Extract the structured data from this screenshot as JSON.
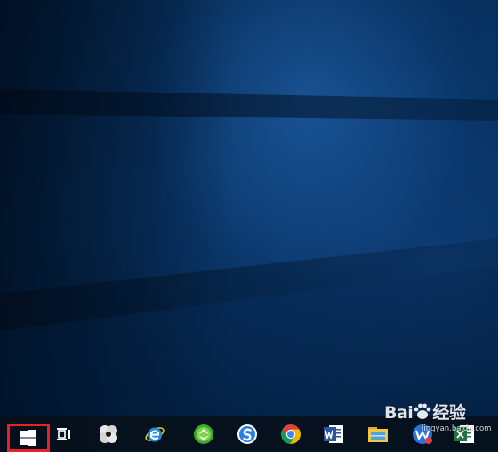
{
  "desktop": {
    "wallpaper": "windows-10-hero-blue",
    "accent_colors": {
      "background_dark": "#021c3a",
      "background_light": "#2a6ebe",
      "taskbar": "#06101c",
      "highlight_border": "#e8202a"
    }
  },
  "taskbar": {
    "items": [
      {
        "name": "start-button",
        "icon": "windows-logo-icon",
        "highlighted": true
      },
      {
        "name": "task-view-button",
        "icon": "task-view-icon"
      },
      {
        "name": "taskbar-app-pinwheel",
        "icon": "pinwheel-app-icon"
      },
      {
        "name": "taskbar-app-internet-explorer",
        "icon": "internet-explorer-icon"
      },
      {
        "name": "taskbar-app-green-browser",
        "icon": "green-browser-icon"
      },
      {
        "name": "taskbar-app-sogou-browser",
        "icon": "sogou-browser-icon"
      },
      {
        "name": "taskbar-app-chrome",
        "icon": "chrome-icon"
      },
      {
        "name": "taskbar-app-word",
        "icon": "word-icon"
      },
      {
        "name": "taskbar-app-file-explorer",
        "icon": "file-explorer-icon"
      },
      {
        "name": "taskbar-app-wps",
        "icon": "wps-icon"
      },
      {
        "name": "taskbar-app-excel",
        "icon": "excel-icon"
      }
    ]
  },
  "watermark": {
    "brand": "Bai",
    "brand_suffix": "经验",
    "url": "jingyan.baidu.com"
  }
}
